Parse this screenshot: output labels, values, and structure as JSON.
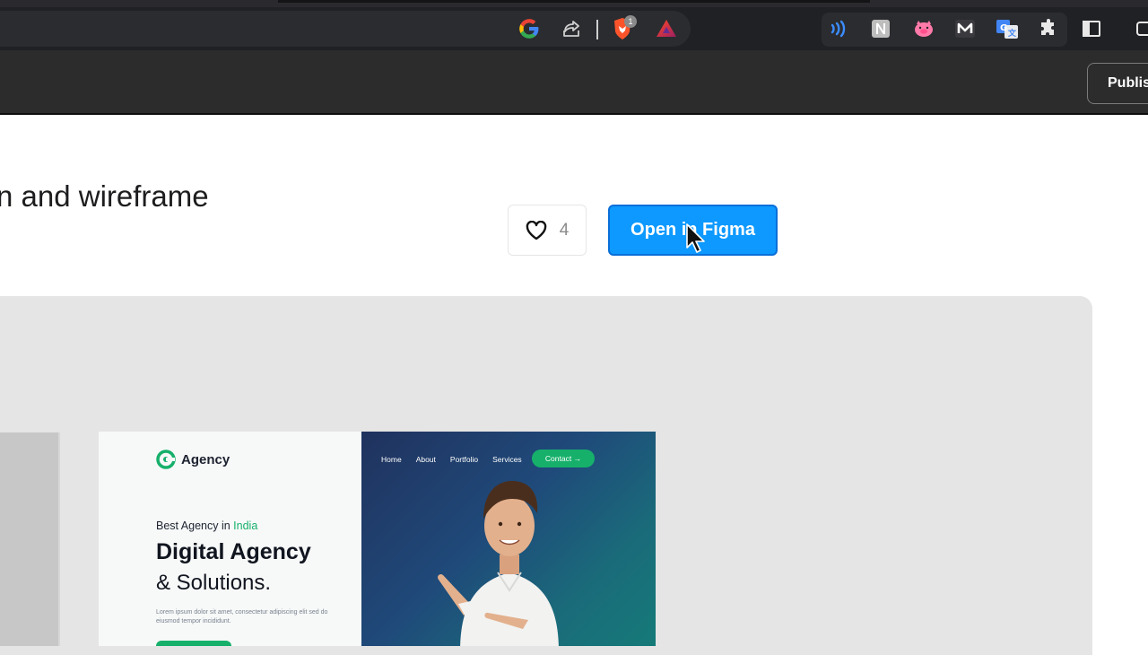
{
  "browser": {
    "extensions": [
      {
        "name": "google-icon"
      },
      {
        "name": "share-icon"
      },
      {
        "name": "brave-shields-icon",
        "badge": "1"
      },
      {
        "name": "brave-rewards-icon"
      },
      {
        "name": "wave-extension-icon"
      },
      {
        "name": "notion-extension-icon"
      },
      {
        "name": "pig-extension-icon"
      },
      {
        "name": "m-extension-icon"
      },
      {
        "name": "translate-extension-icon"
      },
      {
        "name": "puzzle-icon"
      },
      {
        "name": "sidebar-icon"
      },
      {
        "name": "wallet-icon"
      }
    ]
  },
  "header": {
    "publish_label": "Publis"
  },
  "main": {
    "title": "n and wireframe",
    "like_count": "4",
    "open_label": "Open in Figma"
  },
  "preview": {
    "logo": "Agency",
    "tagline_prefix": "Best Agency in ",
    "tagline_highlight": "India",
    "hero_line1": "Digital Agency",
    "hero_line2": "& Solutions.",
    "lorem": "Lorem ipsum dolor sit amet, consectetur adipiscing elit sed do eiusmod tempor incididunt.",
    "nav": [
      "Home",
      "About",
      "Portfolio",
      "Services"
    ],
    "contact": "Contact →"
  },
  "colors": {
    "figma_blue": "#0d99ff",
    "agency_green": "#16b06b",
    "header_dark": "#2c2c2c"
  }
}
